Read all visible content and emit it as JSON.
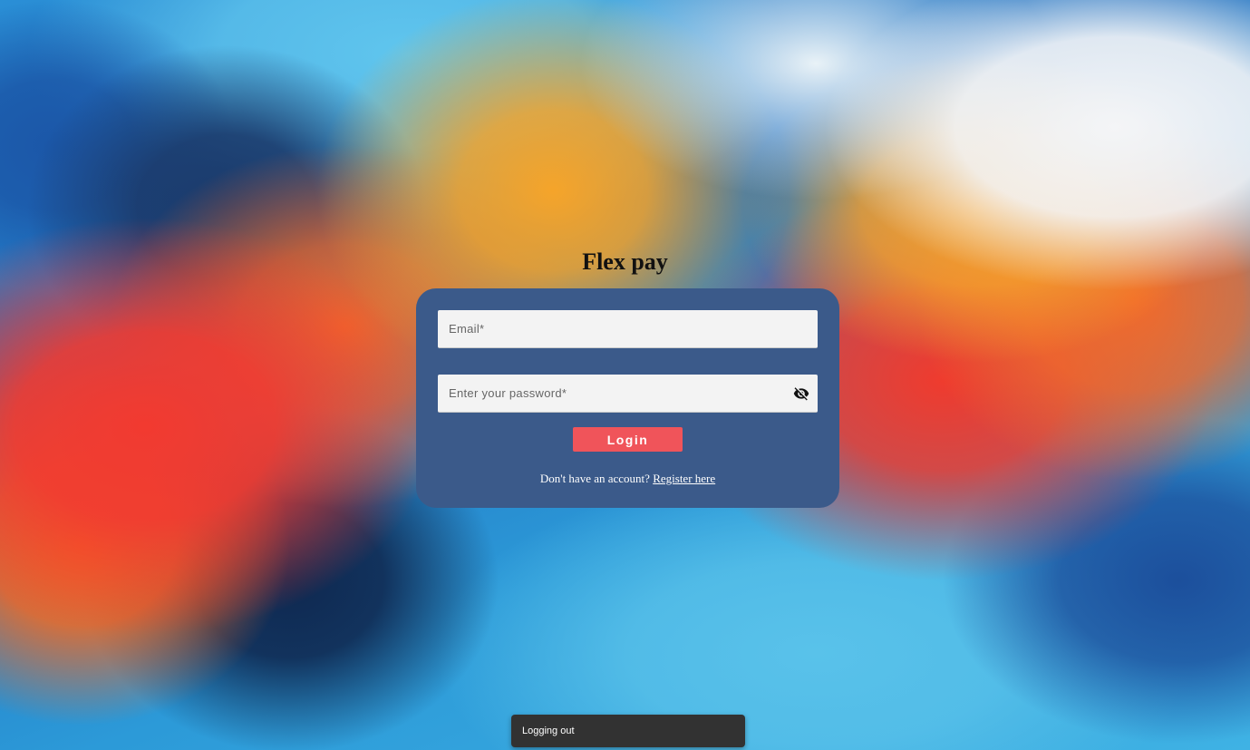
{
  "app": {
    "title": "Flex pay"
  },
  "login_form": {
    "email": {
      "placeholder": "Email*",
      "value": ""
    },
    "password": {
      "placeholder": "Enter your password*",
      "value": "",
      "toggle_icon": "eye-off-icon"
    },
    "login_label": "Login",
    "register_prompt": "Don't have an account?",
    "register_link": "Register here"
  },
  "toast": {
    "message": "Logging out"
  },
  "colors": {
    "card": "#3b5a8a",
    "button": "#f0545a",
    "toast": "#323232"
  }
}
